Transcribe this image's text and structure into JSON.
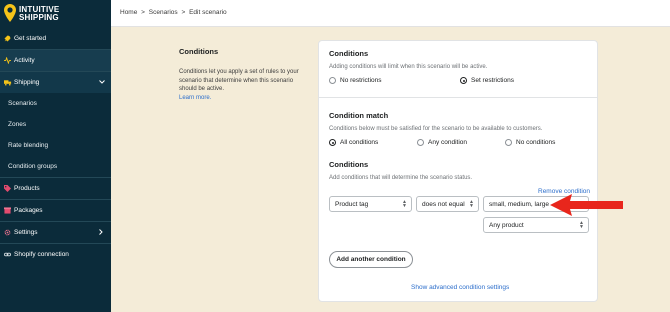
{
  "brand": {
    "line1": "INTUITIVE",
    "line2": "SHIPPING"
  },
  "sidebar": {
    "items": [
      {
        "label": "Get started",
        "icon": "rocket-icon"
      },
      {
        "label": "Activity",
        "icon": "activity-icon"
      },
      {
        "label": "Shipping",
        "icon": "truck-icon"
      },
      {
        "label": "Scenarios"
      },
      {
        "label": "Zones"
      },
      {
        "label": "Rate blending"
      },
      {
        "label": "Condition groups"
      },
      {
        "label": "Products",
        "icon": "tag-icon"
      },
      {
        "label": "Packages",
        "icon": "package-icon"
      },
      {
        "label": "Settings",
        "icon": "gear-icon"
      },
      {
        "label": "Shopify connection",
        "icon": "link-icon"
      }
    ]
  },
  "breadcrumb": {
    "home": "Home",
    "sep": ">",
    "scenarios": "Scenarios",
    "current": "Edit scenario"
  },
  "desc": {
    "title": "Conditions",
    "body": "Conditions let you apply a set of rules to your scenario that determine when this scenario should be active.",
    "learn": "Learn more."
  },
  "card": {
    "conditions": {
      "title": "Conditions",
      "help": "Adding conditions will limit when this scenario will be active.",
      "opt1": "No restrictions",
      "opt2": "Set restrictions"
    },
    "match": {
      "title": "Condition match",
      "help": "Conditions below must be satisfied for the scenario to be available to customers.",
      "opt1": "All conditions",
      "opt2": "Any condition",
      "opt3": "No conditions"
    },
    "list": {
      "title": "Conditions",
      "help": "Add conditions that will determine the scenario status.",
      "remove": "Remove condition",
      "field": "Product tag",
      "operator": "does not equal",
      "value": "small, medium, large",
      "scope": "Any product",
      "add": "Add another condition",
      "advanced": "Show advanced condition settings"
    }
  },
  "colors": {
    "sidebar": "#0b2b3a",
    "accent": "#2c6ecb",
    "background": "#f4ecd8",
    "arrow": "#e8261c",
    "logo": "#f6c419"
  }
}
